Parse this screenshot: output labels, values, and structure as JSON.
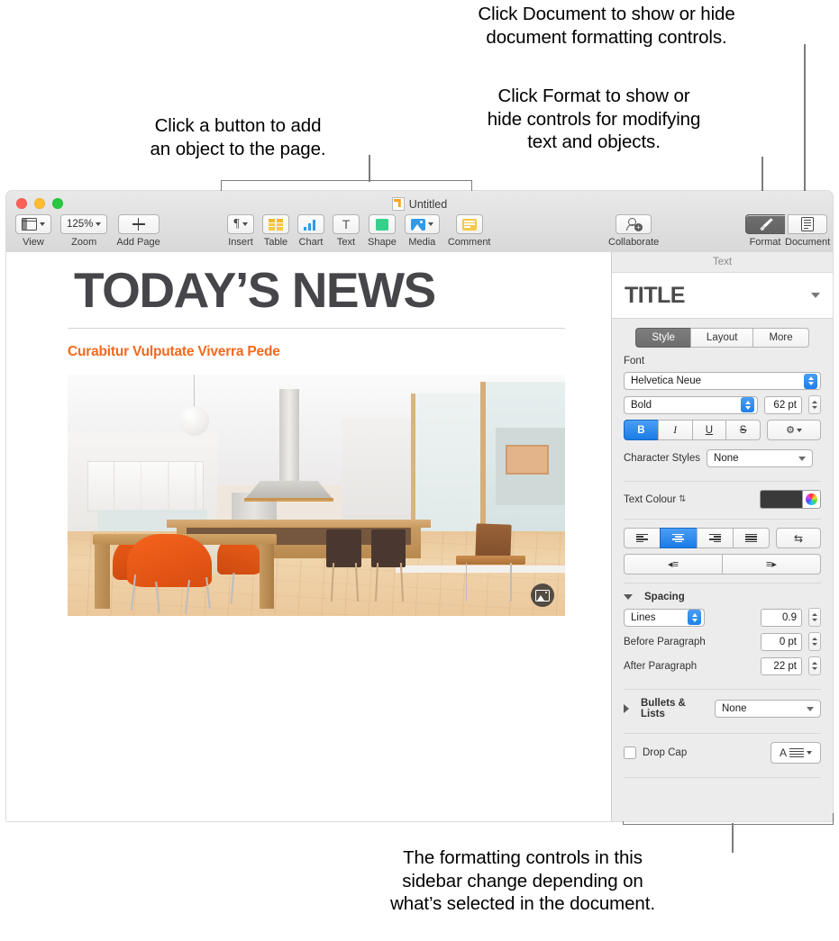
{
  "callouts": {
    "add_object": "Click a button to add\nan object to the page.",
    "document": "Click Document to show or hide\ndocument formatting controls.",
    "format": "Click Format to show or\nhide controls for modifying\ntext and objects.",
    "sidebar": "The formatting controls in this\nsidebar change depending on\nwhat’s selected in the document."
  },
  "window": {
    "title": "Untitled",
    "title_icon": "pages-document-icon"
  },
  "toolbar": {
    "left_items": [
      {
        "label": "View",
        "icon": "view-sidebar-icon",
        "has_chevron": true
      },
      {
        "label": "Zoom",
        "icon": "zoom-percent",
        "value": "125%",
        "has_chevron": true
      },
      {
        "label": "Add Page",
        "icon": "plus-icon",
        "has_chevron": false
      }
    ],
    "center_items": [
      {
        "label": "Insert",
        "icon": "pilcrow-icon",
        "has_chevron": true
      },
      {
        "label": "Table",
        "icon": "table-icon",
        "has_chevron": false
      },
      {
        "label": "Chart",
        "icon": "chart-icon",
        "has_chevron": false
      },
      {
        "label": "Text",
        "icon": "text-T-icon",
        "has_chevron": false
      },
      {
        "label": "Shape",
        "icon": "shape-icon",
        "has_chevron": false
      },
      {
        "label": "Media",
        "icon": "media-icon",
        "has_chevron": true
      },
      {
        "label": "Comment",
        "icon": "comment-icon",
        "has_chevron": false
      }
    ],
    "right_items": [
      {
        "label": "Collaborate",
        "icon": "collaborate-icon",
        "selected": false
      },
      {
        "label": "Format",
        "icon": "format-brush-icon",
        "selected": true
      },
      {
        "label": "Document",
        "icon": "document-icon",
        "selected": false
      }
    ]
  },
  "document": {
    "title": "TODAY’S NEWS",
    "subheading": "Curabitur Vulputate Viverra Pede",
    "subheading_color": "#f4691d",
    "image_placeholder_icon": "media-placeholder-icon"
  },
  "sidebar": {
    "header": "Text",
    "style_name": "TITLE",
    "style_chevron_icon": "chevron-down-icon",
    "tabs": [
      {
        "label": "Style",
        "active": true
      },
      {
        "label": "Layout",
        "active": false
      },
      {
        "label": "More",
        "active": false
      }
    ],
    "font": {
      "section_label": "Font",
      "family": "Helvetica Neue",
      "weight": "Bold",
      "size": "62 pt",
      "bold_label": "B",
      "italic_label": "I",
      "underline_label": "U",
      "strikethrough_label": "S",
      "gear_icon": "gear-icon",
      "bold_active": true
    },
    "character_styles": {
      "label": "Character Styles",
      "value": "None"
    },
    "text_colour": {
      "label": "Text Colour",
      "swatch": "#3a3a3a",
      "wheel_icon": "colour-wheel-icon"
    },
    "alignment": {
      "options": [
        "align-left-icon",
        "align-centre-icon",
        "align-right-icon",
        "align-justify-icon"
      ],
      "active_index": 1,
      "direction_icon": "text-direction-icon",
      "outdent_icon": "decrease-indent-icon",
      "indent_icon": "increase-indent-icon"
    },
    "spacing": {
      "label": "Spacing",
      "expanded": true,
      "mode": "Lines",
      "mode_value": "0.9",
      "before_label": "Before Paragraph",
      "before_value": "0 pt",
      "after_label": "After Paragraph",
      "after_value": "22 pt"
    },
    "bullets": {
      "label": "Bullets & Lists",
      "value": "None",
      "expanded": false
    },
    "drop_cap": {
      "label": "Drop Cap",
      "checked": false,
      "preview_letter": "A",
      "preview_icon": "drop-cap-icon"
    }
  }
}
